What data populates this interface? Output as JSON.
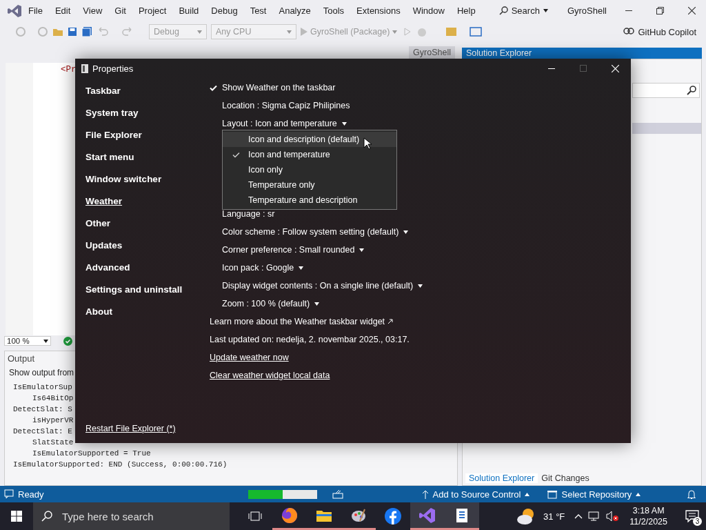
{
  "vs": {
    "menu": [
      "File",
      "Edit",
      "View",
      "Git",
      "Project",
      "Build",
      "Debug",
      "Test",
      "Analyze",
      "Tools",
      "Extensions",
      "Window",
      "Help"
    ],
    "search": "Search",
    "solution_name": "GyroShell",
    "toolbar": {
      "configuration": "Debug",
      "platform": "Any CPU",
      "run_target": "GyroShell (Package)",
      "copilot": "GitHub Copilot"
    },
    "document_tab": "GyroShell",
    "editor": {
      "fragment": "<Pr",
      "zoom": "100 %"
    },
    "output": {
      "title": "Output",
      "source_label": "Show output from",
      "lines": [
        {
          "text": "IsEmulatorSup",
          "kind": "entry"
        },
        {
          "text": "Is64BitOp",
          "kind": "detail"
        },
        {
          "text": "DetectSlat: S",
          "kind": "entry"
        },
        {
          "text": "isHyperVR",
          "kind": "detail"
        },
        {
          "text": "DetectSlat: E",
          "kind": "entry"
        },
        {
          "text": "SlatState",
          "kind": "detail"
        },
        {
          "text": "IsEmulatorSupported = True",
          "kind": "detail"
        },
        {
          "text": "IsEmulatorSupported: END (Success, 0:00:00.716)",
          "kind": "entry"
        }
      ]
    },
    "solution_explorer": {
      "title": "Solution Explorer",
      "tabs": [
        {
          "label": "Solution Explorer",
          "selected": true
        },
        {
          "label": "Git Changes",
          "selected": false
        }
      ]
    },
    "status_bar": {
      "text": "Ready",
      "level": 0.5,
      "source_control": "Add to Source Control",
      "repository": "Select Repository"
    }
  },
  "properties": {
    "title": "Properties",
    "nav": [
      {
        "label": "Taskbar",
        "selected": false
      },
      {
        "label": "System tray",
        "selected": false
      },
      {
        "label": "File Explorer",
        "selected": false
      },
      {
        "label": "Start menu",
        "selected": false
      },
      {
        "label": "Window switcher",
        "selected": false
      },
      {
        "label": "Weather",
        "selected": true
      },
      {
        "label": "Other",
        "selected": false
      },
      {
        "label": "Updates",
        "selected": false
      },
      {
        "label": "Advanced",
        "selected": false
      },
      {
        "label": "Settings and uninstall",
        "selected": false
      },
      {
        "label": "About",
        "selected": false
      }
    ],
    "restart_link": "Restart File Explorer (*)",
    "show_on_taskbar": {
      "label": "Show Weather on the taskbar",
      "checked": true
    },
    "settings": [
      {
        "label": "Location : Sigma Capiz Philipines",
        "dropdown": false
      },
      {
        "label": "Layout : Icon and temperature",
        "dropdown": true,
        "expanded": true,
        "options": [
          {
            "label": "Icon and description (default)",
            "checked": false,
            "hovered": true
          },
          {
            "label": "Icon and temperature",
            "checked": true,
            "hovered": false
          },
          {
            "label": "Icon only",
            "checked": false,
            "hovered": false
          },
          {
            "label": "Temperature only",
            "checked": false,
            "hovered": false
          },
          {
            "label": "Temperature and description",
            "checked": false,
            "hovered": false
          }
        ]
      },
      {
        "label": "Language : sr",
        "dropdown": false
      },
      {
        "label": "Color scheme : Follow system setting (default)",
        "dropdown": true
      },
      {
        "label": "Corner preference : Small rounded",
        "dropdown": true
      },
      {
        "label": "Icon pack : Google",
        "dropdown": true
      },
      {
        "label": "Display widget contents : On a single line (default)",
        "dropdown": true
      },
      {
        "label": "Zoom : 100 % (default)",
        "dropdown": true
      }
    ],
    "learn_more": "Learn more about the Weather taskbar widget",
    "last_updated": "Last updated on: nedelja, 2. novembar 2025., 03:17.",
    "links": [
      "Update weather now",
      "Clear weather widget local data"
    ]
  },
  "taskbar": {
    "search_placeholder": "Type here to search",
    "temperature": "31 °F",
    "time": "3:18 AM",
    "date": "11/2/2025",
    "notifications": "3"
  }
}
